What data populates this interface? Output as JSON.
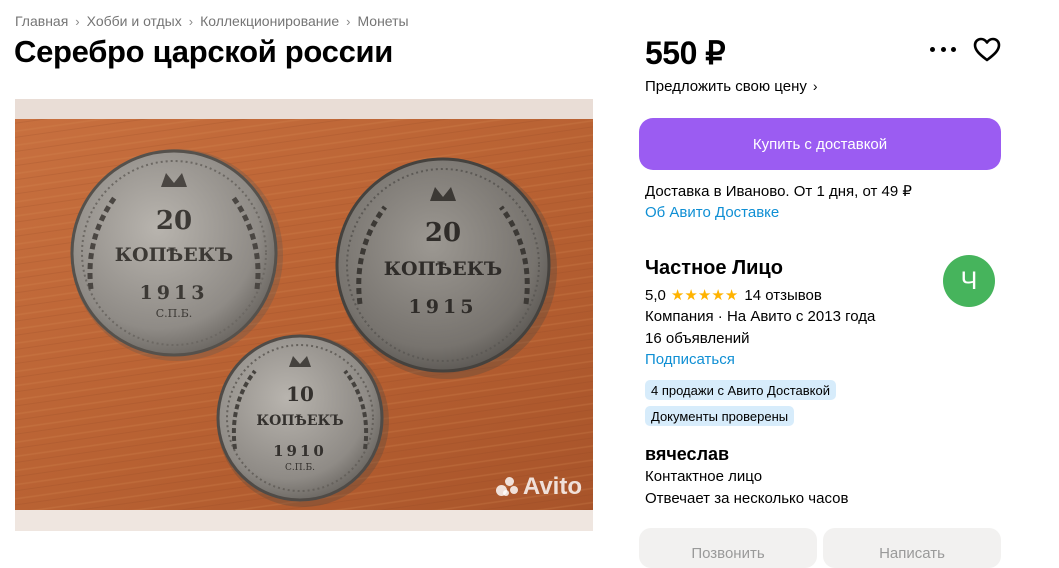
{
  "breadcrumbs": [
    {
      "label": "Главная"
    },
    {
      "label": "Хобби и отдых"
    },
    {
      "label": "Коллекционирование"
    },
    {
      "label": "Монеты"
    }
  ],
  "title": "Серебро царской россии",
  "photo": {
    "watermark": "Avito",
    "coins": [
      {
        "denomination": "20",
        "word": "КОПѢЕКЪ",
        "year": "1913",
        "mint": "С.П.Б."
      },
      {
        "denomination": "20",
        "word": "КОПѢЕКЪ",
        "year": "1915",
        "mint": ""
      },
      {
        "denomination": "10",
        "word": "КОПѢЕКЪ",
        "year": "1910",
        "mint": "С.П.Б."
      }
    ]
  },
  "price": "550 ₽",
  "offer_price": "Предложить свою цену",
  "buy_button": "Купить с доставкой",
  "delivery": {
    "text": "Доставка в Иваново. От 1 дня, от 49 ₽",
    "link": "Об Авито Доставке"
  },
  "seller": {
    "name": "Частное Лицо",
    "avatar_letter": "Ч",
    "rating": "5,0",
    "reviews": "14 отзывов",
    "company": "Компания · На Авито с 2013 года",
    "listings": "16 объявлений",
    "subscribe": "Подписаться",
    "badges": [
      "4 продажи с Авито Доставкой",
      "Документы проверены"
    ]
  },
  "contact": {
    "name": "вячеслав",
    "role": "Контактное лицо",
    "response": "Отвечает за несколько часов"
  },
  "bottom_buttons": [
    "Позвонить",
    "Написать"
  ],
  "colors": {
    "accent": "#9b5cf2",
    "link": "#0f8fd4",
    "avatar": "#46b45c",
    "star": "#ffb300",
    "badge": "#d7ecfb"
  },
  "icons": [
    "chevron-right-icon",
    "more-dots-icon",
    "heart-icon",
    "star-icon",
    "avito-logo-icon"
  ]
}
